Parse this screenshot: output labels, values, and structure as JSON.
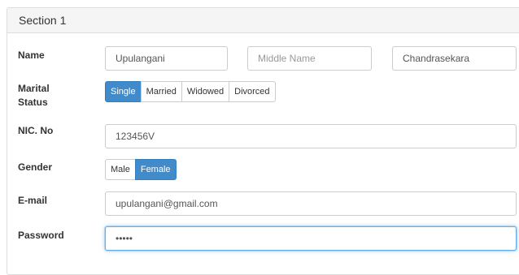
{
  "section": {
    "title": "Section 1"
  },
  "form": {
    "name": {
      "label": "Name",
      "first": {
        "value": "Upulangani",
        "placeholder": ""
      },
      "middle": {
        "value": "",
        "placeholder": "Middle Name"
      },
      "last": {
        "value": "Chandrasekara",
        "placeholder": ""
      }
    },
    "marital": {
      "label_line1": "Marital",
      "label_line2": "Status",
      "options": [
        "Single",
        "Married",
        "Widowed",
        "Divorced"
      ],
      "selected": "Single"
    },
    "nic": {
      "label": "NIC. No",
      "value": "123456V"
    },
    "gender": {
      "label": "Gender",
      "options": [
        "Male",
        "Female"
      ],
      "selected": "Female"
    },
    "email": {
      "label": "E-mail",
      "value": "upulangani@gmail.com"
    },
    "password": {
      "label": "Password",
      "value": "•••••"
    }
  },
  "colors": {
    "accent": "#428bca",
    "focus_border": "#66afe9",
    "heading_bg": "#f5f5f5"
  }
}
